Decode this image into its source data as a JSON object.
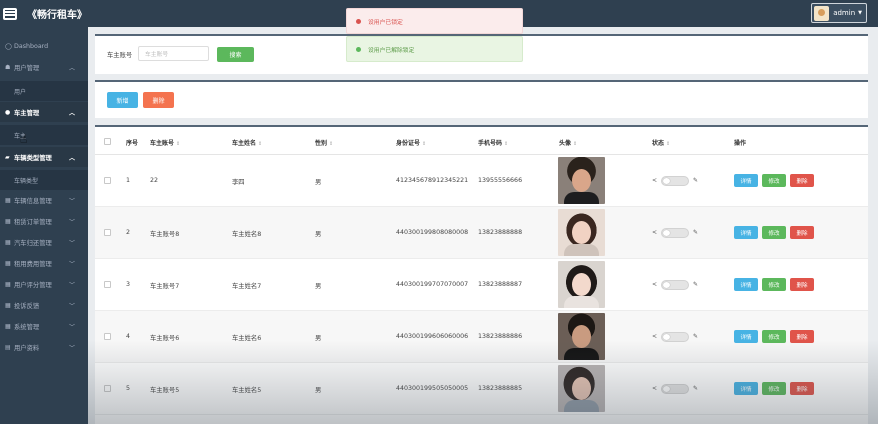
{
  "app": {
    "title": "《畅行租车》"
  },
  "user": {
    "name": "admin"
  },
  "sidebar": {
    "items": [
      {
        "label": "Dashboard",
        "icon": "circle-icon"
      },
      {
        "label": "用户管理",
        "icon": "users-icon"
      },
      {
        "label": "用户",
        "sub": true
      },
      {
        "label": "车主管理",
        "icon": "pin-icon",
        "active": true
      },
      {
        "label": "车主",
        "sub": true
      },
      {
        "label": "车辆类型管理",
        "icon": "car-icon",
        "active": true
      },
      {
        "label": "车辆类型",
        "sub": true
      },
      {
        "label": "车辆信息管理",
        "icon": "grid-icon"
      },
      {
        "label": "租赁订单管理",
        "icon": "grid-icon"
      },
      {
        "label": "汽车归还管理",
        "icon": "grid-icon"
      },
      {
        "label": "租用费用管理",
        "icon": "grid-icon"
      },
      {
        "label": "用户评分管理",
        "icon": "grid-icon"
      },
      {
        "label": "投诉反馈",
        "icon": "grid-icon"
      },
      {
        "label": "系统管理",
        "icon": "grid-icon"
      },
      {
        "label": "用户资料",
        "icon": "doc-icon"
      }
    ]
  },
  "search": {
    "label": "车主账号",
    "placeholder": "车主账号",
    "button": "搜索"
  },
  "actions": {
    "add": "新增",
    "delete": "删除"
  },
  "toasts": [
    {
      "text": "设用户已锁定",
      "type": "error"
    },
    {
      "text": "设用户已解除锁定",
      "type": "success"
    }
  ],
  "table": {
    "columns": [
      "序号",
      "车主账号",
      "车主姓名",
      "性别",
      "身份证号",
      "手机号码",
      "头像",
      "状态",
      "操作"
    ],
    "row_buttons": {
      "detail": "详情",
      "edit": "修改",
      "delete": "删除"
    },
    "rows": [
      {
        "index": "1",
        "account": "22",
        "name": "李四",
        "gender": "男",
        "id_card": "412345678912345221",
        "phone": "13955556666"
      },
      {
        "index": "2",
        "account": "车主账号8",
        "name": "车主姓名8",
        "gender": "男",
        "id_card": "440300199808080008",
        "phone": "13823888888"
      },
      {
        "index": "3",
        "account": "车主账号7",
        "name": "车主姓名7",
        "gender": "男",
        "id_card": "440300199707070007",
        "phone": "13823888887"
      },
      {
        "index": "4",
        "account": "车主账号6",
        "name": "车主姓名6",
        "gender": "男",
        "id_card": "440300199606060006",
        "phone": "13823888886"
      },
      {
        "index": "5",
        "account": "车主账号5",
        "name": "车主姓名5",
        "gender": "男",
        "id_card": "440300199505050005",
        "phone": "13823888885"
      }
    ]
  },
  "colors": {
    "header": "#2f4050",
    "info": "#47b3e4",
    "success": "#5cb85c",
    "danger": "#e0544a"
  }
}
